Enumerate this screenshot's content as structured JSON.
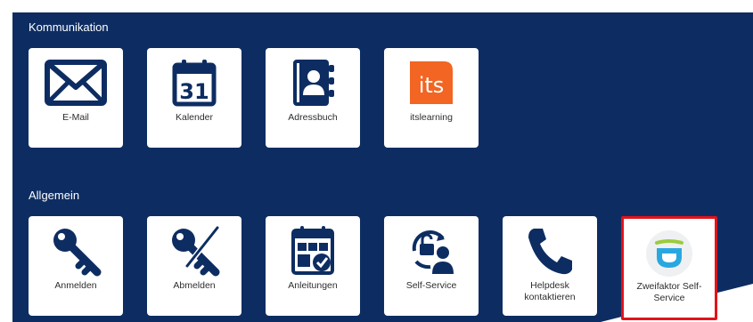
{
  "sections": [
    {
      "title": "Kommunikation",
      "items": [
        {
          "label": "E-Mail",
          "icon": "envelope-icon"
        },
        {
          "label": "Kalender",
          "icon": "calendar-icon"
        },
        {
          "label": "Adressbuch",
          "icon": "address-book-icon"
        },
        {
          "label": "itslearning",
          "icon": "itslearning-logo-icon",
          "logo_text": "its"
        }
      ]
    },
    {
      "title": "Allgemein",
      "items": [
        {
          "label": "Anmelden",
          "icon": "key-icon"
        },
        {
          "label": "Abmelden",
          "icon": "key-crossed-icon"
        },
        {
          "label": "Anleitungen",
          "icon": "guide-icon"
        },
        {
          "label": "Self-Service",
          "icon": "self-service-icon"
        },
        {
          "label": "Helpdesk kontaktieren",
          "icon": "phone-icon"
        },
        {
          "label": "Zweifaktor Self-Service",
          "icon": "two-factor-icon",
          "highlighted": true
        }
      ]
    }
  ],
  "colors": {
    "background": "#0d2d62",
    "tile": "#ffffff",
    "icon": "#0d2d62",
    "highlight_border": "#e3121b",
    "itslearning": "#f26522"
  }
}
